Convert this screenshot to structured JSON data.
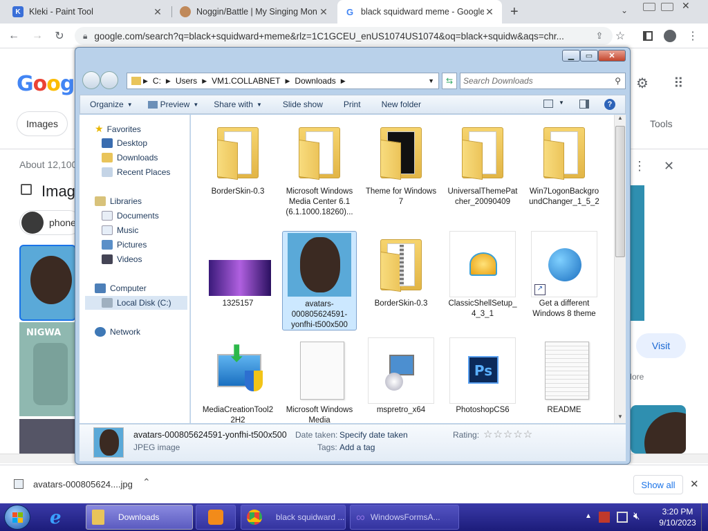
{
  "chrome": {
    "tabs": [
      {
        "title": "Kleki - Paint Tool",
        "fav_color": "#3a6fd8",
        "fav_letter": "K"
      },
      {
        "title": "Noggin/Battle | My Singing Mon",
        "fav_color": "#c0895a",
        "fav_letter": ""
      },
      {
        "title": "black squidward meme - Google",
        "fav_color": "#4285f4",
        "fav_letter": "G"
      }
    ],
    "url": "google.com/search?q=black+squidward+meme&rlz=1C1GCEU_enUS1074US1074&oq=black+squidw&aqs=chr...",
    "new_tab": "+"
  },
  "google": {
    "logo": "Googl",
    "chip_images": "Images",
    "tools": "Tools",
    "about": "About 12,100",
    "images_heading": "Image",
    "phone_chip": "phone",
    "visit": "Visit",
    "more": "More",
    "nigwa": "NIGWA"
  },
  "explorer": {
    "address": [
      "C:",
      "Users",
      "VM1.COLLABNET",
      "Downloads"
    ],
    "search_placeholder": "Search Downloads",
    "commands": [
      {
        "label": "Organize",
        "dropdown": true
      },
      {
        "label": "Preview",
        "dropdown": true
      },
      {
        "label": "Share with",
        "dropdown": true
      },
      {
        "label": "Slide show",
        "dropdown": false
      },
      {
        "label": "Print",
        "dropdown": false
      },
      {
        "label": "New folder",
        "dropdown": false
      }
    ],
    "nav": {
      "favorites": "Favorites",
      "desktop": "Desktop",
      "downloads": "Downloads",
      "recent": "Recent Places",
      "libraries": "Libraries",
      "documents": "Documents",
      "music": "Music",
      "pictures": "Pictures",
      "videos": "Videos",
      "computer": "Computer",
      "localdisk": "Local Disk (C:)",
      "network": "Network"
    },
    "items": [
      {
        "label": "BorderSkin-0.3",
        "kind": "folder"
      },
      {
        "label": "Microsoft Windows Media Center 6.1 (6.1.1000.18260)...",
        "kind": "folder"
      },
      {
        "label": "Theme for Windows 7",
        "kind": "folder"
      },
      {
        "label": "UniversalThemePatcher_20090409",
        "kind": "folder"
      },
      {
        "label": "Win7LogonBackgroundChanger_1_5_2",
        "kind": "folder"
      },
      {
        "label": "1325157",
        "kind": "image"
      },
      {
        "label": "avatars-000805624591-yonfhi-t500x500",
        "kind": "image"
      },
      {
        "label": "BorderSkin-0.3",
        "kind": "zip"
      },
      {
        "label": "ClassicShellSetup_4_3_1",
        "kind": "exe"
      },
      {
        "label": "Get a different Windows 8 theme",
        "kind": "link"
      },
      {
        "label": "MediaCreationTool22H2",
        "kind": "exe"
      },
      {
        "label": "Microsoft Windows Media",
        "kind": "doc"
      },
      {
        "label": "mspretro_x64",
        "kind": "exe"
      },
      {
        "label": "PhotoshopCS6",
        "kind": "exe"
      },
      {
        "label": "README",
        "kind": "doc"
      }
    ],
    "details": {
      "name": "avatars-000805624591-yonfhi-t500x500",
      "type": "JPEG image",
      "date_label": "Date taken:",
      "date_value": "Specify date taken",
      "tags_label": "Tags:",
      "tags_value": "Add a tag",
      "rating_label": "Rating:",
      "stars": "☆☆☆☆☆"
    }
  },
  "downloads_bar": {
    "file": "avatars-000805624....jpg",
    "show_all": "Show all"
  },
  "taskbar": {
    "downloads": "Downloads",
    "chrome": "black squidward ...",
    "app": "WindowsFormsA...",
    "time": "3:20 PM",
    "date": "9/10/2023"
  }
}
